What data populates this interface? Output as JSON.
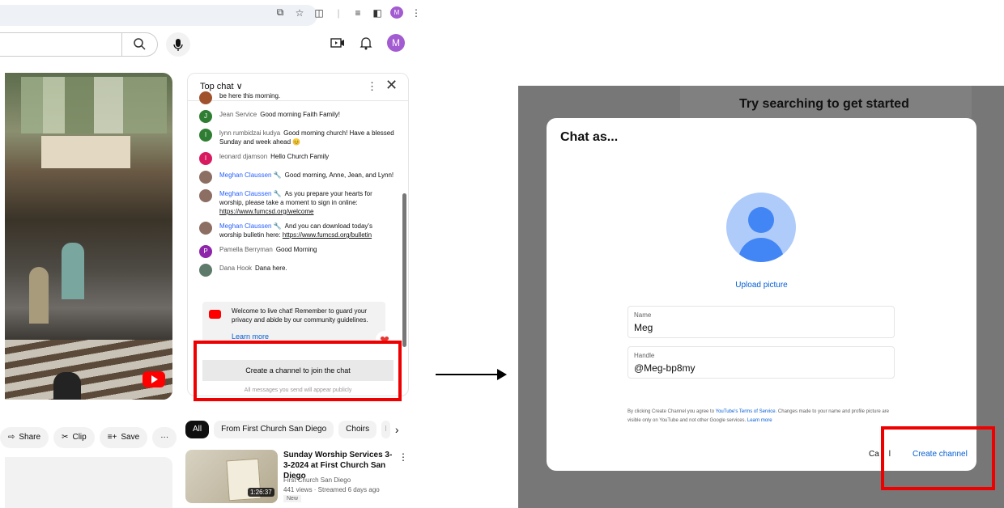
{
  "browser": {
    "profile_initial": "M"
  },
  "youtube": {
    "profile_initial": "M"
  },
  "chat": {
    "title": "Top chat ∨",
    "messages": [
      {
        "initial": "",
        "color": "#a0522d",
        "author": "",
        "text": "be here this morning.",
        "mod": false
      },
      {
        "initial": "J",
        "color": "#2e7d32",
        "author": "Jean Service",
        "text": "Good morning Faith Family!",
        "mod": false
      },
      {
        "initial": "l",
        "color": "#2e7d32",
        "author": "lynn rumbidzai kudya",
        "text": "Good morning church! Have a blessed Sunday and week ahead 😊",
        "mod": false
      },
      {
        "initial": "l",
        "color": "#d81b60",
        "author": "leonard djamson",
        "text": "Hello Church Family",
        "mod": false
      },
      {
        "initial": "",
        "color": "#8d6e63",
        "author": "Meghan Claussen 🔧",
        "text": "Good morning, Anne, Jean, and Lynn!",
        "mod": true
      },
      {
        "initial": "",
        "color": "#8d6e63",
        "author": "Meghan Claussen 🔧",
        "text": "As you prepare your hearts for worship, please take a moment to sign in online: ",
        "link": "https://www.fumcsd.org/welcome",
        "mod": true
      },
      {
        "initial": "",
        "color": "#8d6e63",
        "author": "Meghan Claussen 🔧",
        "text": "And you can download today's worship bulletin here: ",
        "link": "https://www.fumcsd.org/bulletin",
        "mod": true
      },
      {
        "initial": "P",
        "color": "#8e24aa",
        "author": "Pamella Berryman",
        "text": "Good Morning",
        "mod": false
      },
      {
        "initial": "",
        "color": "#5d7a6a",
        "author": "Dana Hook",
        "text": "Dana here.",
        "mod": false
      }
    ],
    "welcome_text": "Welcome to live chat! Remember to guard your privacy and abide by our community guidelines.",
    "learn_more": "Learn more",
    "create_channel_btn": "Create a channel to join the chat",
    "public_note": "All messages you send will appear publicly"
  },
  "actions": [
    {
      "icon": "share-icon",
      "glyph": "⇨",
      "label": "Share"
    },
    {
      "icon": "clip-icon",
      "glyph": "✂",
      "label": "Clip"
    },
    {
      "icon": "save-icon",
      "glyph": "≡+",
      "label": "Save"
    },
    {
      "icon": "more-icon",
      "glyph": "···",
      "label": ""
    }
  ],
  "filters": [
    "All",
    "From First Church San Diego",
    "Choirs",
    "I"
  ],
  "recommended": {
    "title": "Sunday Worship Services 3-3-2024 at First Church San Diego",
    "channel": "First Church San Diego",
    "stats": "441 views · Streamed 6 days ago",
    "badge": "New",
    "duration": "1:26:37"
  },
  "dialog": {
    "background_heading": "Try searching to get started",
    "title": "Chat as...",
    "upload": "Upload picture",
    "name_label": "Name",
    "name_value": "Meg",
    "handle_label": "Handle",
    "handle_value": "@Meg-bp8my",
    "terms_1": "By clicking Create Channel you agree to ",
    "terms_link": "YouTube's Terms of Service",
    "terms_2": ". Changes made to your name and profile picture are visible only on YouTube and not other Google services. ",
    "terms_learn": "Learn more",
    "cancel": "Ca",
    "cancel_end": "l",
    "create": "Create channel"
  },
  "colors": {
    "highlight": "#e00000",
    "link": "#065fd4",
    "moderator": "#2962ff"
  }
}
